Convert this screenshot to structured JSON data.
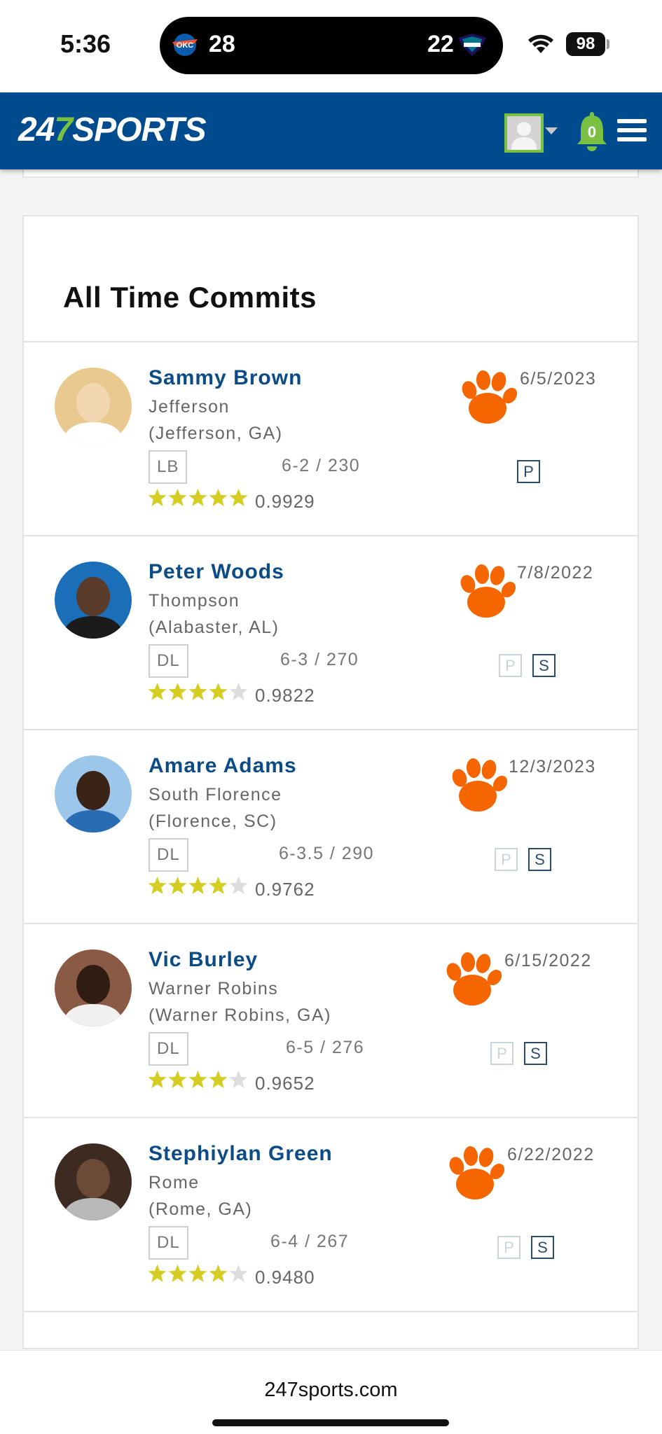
{
  "status_bar": {
    "time": "5:36",
    "away_score": "28",
    "home_score": "22",
    "battery": "98"
  },
  "header": {
    "logo_prefix": "24",
    "logo_seven": "7",
    "logo_suffix": "SPORTS",
    "notification_count": "0",
    "brand_color": "#004b8d",
    "accent_color": "#7ac143"
  },
  "section": {
    "title": "All Time Commits"
  },
  "commits": [
    {
      "name": "Sammy Brown",
      "school": "Jefferson",
      "hometown": "(Jefferson, GA)",
      "position": "LB",
      "size": "6-2 / 230",
      "stars": 5,
      "rating": "0.9929",
      "date": "6/5/2023",
      "p_active": true,
      "s_shown": false
    },
    {
      "name": "Peter Woods",
      "school": "Thompson",
      "hometown": "(Alabaster, AL)",
      "position": "DL",
      "size": "6-3 / 270",
      "stars": 4,
      "rating": "0.9822",
      "date": "7/8/2022",
      "p_active": false,
      "s_shown": true
    },
    {
      "name": "Amare Adams",
      "school": "South Florence",
      "hometown": "(Florence, SC)",
      "position": "DL",
      "size": "6-3.5 / 290",
      "stars": 4,
      "rating": "0.9762",
      "date": "12/3/2023",
      "p_active": false,
      "s_shown": true
    },
    {
      "name": "Vic Burley",
      "school": "Warner Robins",
      "hometown": "(Warner Robins, GA)",
      "position": "DL",
      "size": "6-5 / 276",
      "stars": 4,
      "rating": "0.9652",
      "date": "6/15/2022",
      "p_active": false,
      "s_shown": true
    },
    {
      "name": "Stephiylan Green",
      "school": "Rome",
      "hometown": "(Rome, GA)",
      "position": "DL",
      "size": "6-4 / 267",
      "stars": 4,
      "rating": "0.9480",
      "date": "6/22/2022",
      "p_active": false,
      "s_shown": true
    }
  ],
  "ps_labels": {
    "p": "P",
    "s": "S"
  },
  "footer": {
    "url": "247sports.com"
  },
  "colors": {
    "star_filled": "#d6cd23",
    "star_empty": "#dddddd",
    "paw": "#f56600",
    "link_name": "#0c4c86"
  }
}
